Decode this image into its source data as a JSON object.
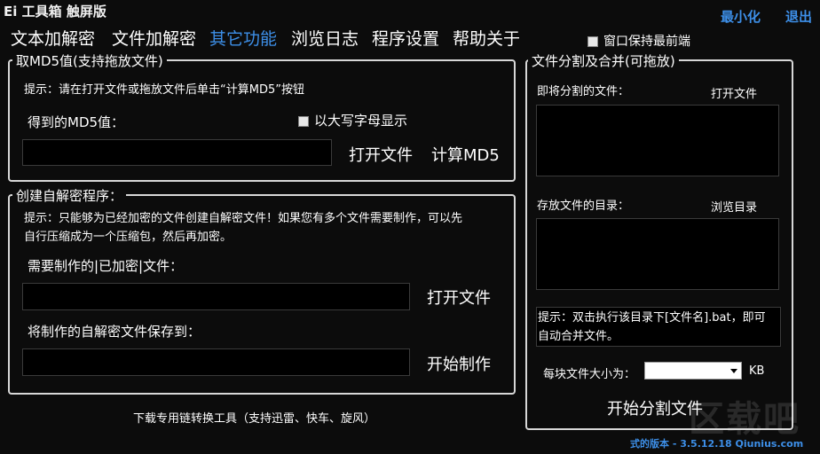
{
  "app_title": "Ei 工具箱 触屏版",
  "window": {
    "minimize_label": "最小化",
    "exit_label": "退出"
  },
  "tabs": [
    {
      "label": "文本加解密"
    },
    {
      "label": "文件加解密"
    },
    {
      "label": "其它功能",
      "active": true
    },
    {
      "label": "浏览日志"
    },
    {
      "label": "程序设置"
    },
    {
      "label": "帮助关于"
    }
  ],
  "always_on_top": {
    "label": "窗口保持最前端",
    "checked": true
  },
  "md5": {
    "title": "取MD5值(支持拖放文件)",
    "hint": "提示：请在打开文件或拖放文件后单击“计算MD5”按钮",
    "result_label": "得到的MD5值：",
    "uppercase_label": "以大写字母显示",
    "uppercase_checked": true,
    "result_value": "",
    "open_label": "打开文件",
    "compute_label": "计算MD5"
  },
  "selfdec": {
    "title": "创建自解密程序：",
    "hint_line1": "提示：只能够为已经加密的文件创建自解密文件！如果您有多个文件需要制作，可以先",
    "hint_line2": "自行压缩成为一个压缩包，然后再加密。",
    "source_label": "需要制作的|已加密|文件：",
    "source_value": "",
    "open_label": "打开文件",
    "save_label": "将制作的自解密文件保存到：",
    "save_value": "",
    "start_label": "开始制作"
  },
  "download_link": "下载专用链转换工具（支持迅雷、快车、旋风）",
  "split": {
    "title": "文件分割及合并(可拖放)",
    "file_label": "即将分割的文件：",
    "open_label": "打开文件",
    "dir_label": "存放文件的目录：",
    "browse_label": "浏览目录",
    "note_line1": "提示：双击执行该目录下[文件名].bat，即可",
    "note_line2": "自动合并文件。",
    "size_label": "每块文件大小为：",
    "size_value": "",
    "size_unit": "KB",
    "start_label": "开始分割文件"
  },
  "watermark": "区载吧",
  "version_text": "式的版本 - 3.5.12.18 Qiunius.com",
  "colors": {
    "accent": "#3d8fe8",
    "background": "#0c0c0c",
    "border": "#d8d8d8"
  }
}
